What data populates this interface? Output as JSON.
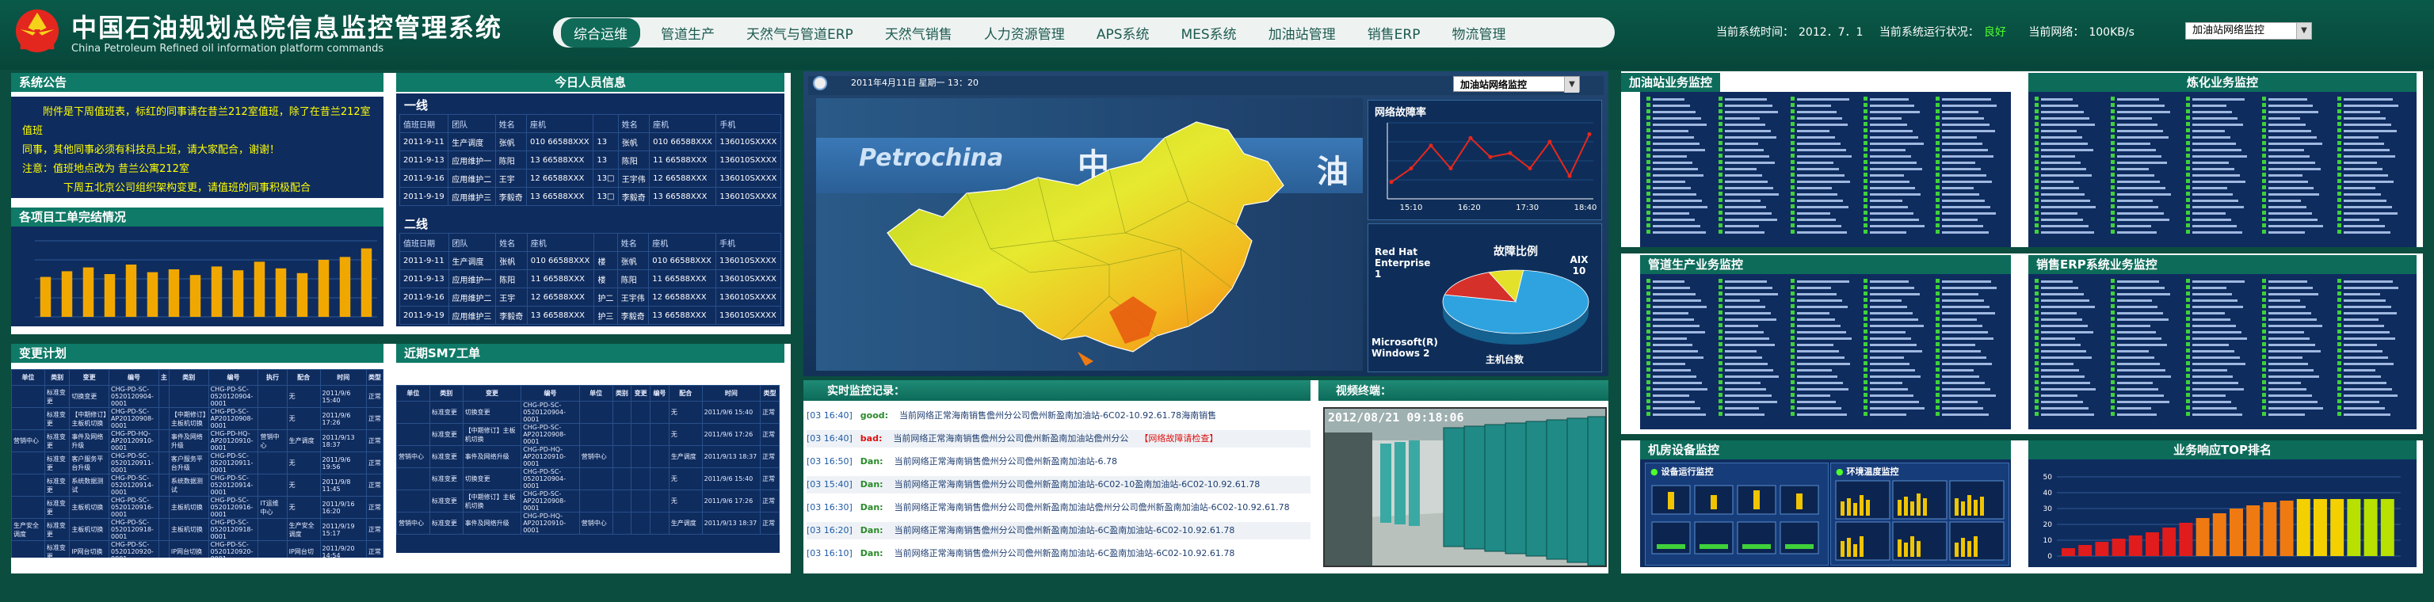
{
  "header": {
    "title_cn": "中国石油规划总院信息监控管理系统",
    "title_en": "China Petroleum Refined oil information platform commands",
    "nav": [
      "综合运维",
      "管道生产",
      "天然气与管道ERP",
      "天然气销售",
      "人力资源管理",
      "APS系统",
      "MES系统",
      "加油站管理",
      "销售ERP",
      "物流管理"
    ],
    "status": {
      "time_label": "当前系统时间：",
      "time_value": "2012．7．1",
      "run_label": "当前系统运行状况：",
      "run_value": "良好",
      "net_label": "当前网络：",
      "net_value": "100KB/s"
    },
    "select_value": "加油站网络监控"
  },
  "notice": {
    "title": "系统公告",
    "lines": [
      "附件是下周值班表，标红的同事请在昔兰212室值班，除了在昔兰212室值班",
      "同事，其他同事必须有科技员上班，请大家配合，谢谢！",
      "注意：值班地点改为  昔兰公寓212室",
      "下周五北京公司组织架构变更，请值班的同事积极配合"
    ]
  },
  "bar_chart": {
    "title": "各项目工单完结情况",
    "type": "bar",
    "values": [
      42,
      48,
      52,
      45,
      55,
      47,
      50,
      44,
      53,
      49,
      58,
      51,
      46,
      60,
      63,
      72
    ]
  },
  "duty": {
    "title": "今日人员信息",
    "line1": "一线",
    "line2": "二线",
    "headers": [
      "值班日期",
      "团队",
      "姓名",
      "座机",
      "",
      "姓名",
      "座机",
      "手机"
    ],
    "rows1": [
      [
        "2011-9-11",
        "生产调度",
        "张帆",
        "010 66588XXX",
        "13",
        "张帆",
        "010 66588XXX",
        "136010SXXXX"
      ],
      [
        "2011-9-13",
        "应用维护一",
        "陈阳",
        "13 66588XXX",
        "13",
        "陈阳",
        "11 66588XXX",
        "136010SXXXX"
      ],
      [
        "2011-9-16",
        "应用维护二",
        "王宇",
        "12 66588XXX",
        "13□",
        "王宇伟",
        "12 66588XXX",
        "136010SXXXX"
      ],
      [
        "2011-9-19",
        "应用维护三",
        "李毅奇",
        "13 66588XXX",
        "13□",
        "李毅奇",
        "13 66588XXX",
        "136010SXXXX"
      ]
    ],
    "rows2": [
      [
        "2011-9-11",
        "生产调度",
        "张帆",
        "010 66588XXX",
        "楼",
        "张帆",
        "010 66588XXX",
        "136010SXXXX"
      ],
      [
        "2011-9-13",
        "应用维护一",
        "陈阳",
        "11 66588XXX",
        "楼",
        "陈阳",
        "11 66588XXX",
        "136010SXXXX"
      ],
      [
        "2011-9-16",
        "应用维护二",
        "王宇",
        "12 66588XXX",
        "护二",
        "王宇伟",
        "12 66588XXX",
        "136010SXXXX"
      ],
      [
        "2011-9-19",
        "应用维护三",
        "李毅奇",
        "13 66588XXX",
        "护三",
        "李毅奇",
        "13 66588XXX",
        "136010SXXXX"
      ]
    ]
  },
  "change": {
    "title": "变更计划",
    "headers": [
      "单位",
      "类别",
      "变更",
      "编号",
      "主",
      "类别",
      "编号",
      "执行",
      "配合",
      "时间",
      "类型"
    ],
    "rows": [
      [
        "",
        "标准变更",
        "切换变更",
        "CHG-PD-SC-0520120904-0001",
        "",
        "",
        "CHG-PD-SC-0520120904-0001",
        "",
        "无",
        "2011/9/6 15:40",
        "正常"
      ],
      [
        "",
        "标准变更",
        "【中期修订】主板机切换",
        "CHG-PD-SC-AP20120908-0001",
        "",
        "【中期修订】主板机切换",
        "CHG-PD-SC-AP20120908-0001",
        "",
        "无",
        "2011/9/6 17:26",
        "正常"
      ],
      [
        "营销中心",
        "标准变更",
        "事件及网络升级",
        "CHG-PD-HQ-AP20120910-0001",
        "",
        "事件及网络升级",
        "CHG-PD-HQ-AP20120910-0001",
        "营销中心",
        "生产调度",
        "2011/9/13 18:37",
        "正常"
      ],
      [
        "",
        "标准变更",
        "客户服务平台升级",
        "CHG-PD-SC-0520120911-0001",
        "",
        "客户服务平台升级",
        "CHG-PD-SC-0520120911-0001",
        "",
        "无",
        "2011/9/6 19:56",
        "正常"
      ],
      [
        "",
        "标准变更",
        "系统数据测试",
        "CHG-PD-SC-0520120914-0001",
        "",
        "系统数据测试",
        "CHG-PD-SC-0520120914-0001",
        "",
        "无",
        "2011/9/8 11:45",
        "正常"
      ],
      [
        "",
        "标准变更",
        "主板机切换",
        "CHG-PD-SC-0520120916-0001",
        "",
        "主板机切换",
        "CHG-PD-SC-0520120916-0001",
        "IT运维中心",
        "无",
        "2011/9/16 16:20",
        "正常"
      ],
      [
        "生产安全调度",
        "标准变更",
        "主板机切换",
        "CHG-PD-SC-0520120918-0001",
        "",
        "主板机切换",
        "CHG-PD-SC-0520120918-0001",
        "",
        "生产安全调度",
        "2011/9/19 15:17",
        "正常"
      ],
      [
        "",
        "标准变更",
        "IP网台切换",
        "CHG-PD-SC-0520120920-0001",
        "",
        "IP网台切换",
        "CHG-PD-SC-0520120920-0001",
        "",
        "IP网台切",
        "2011/9/20 14:54",
        "正常"
      ]
    ]
  },
  "sm7": {
    "title": "近期SM7工单",
    "headers": [
      "单位",
      "类别",
      "变更",
      "编号",
      "单位",
      "类别",
      "变更",
      "编号",
      "配合",
      "时间",
      "类型"
    ],
    "rows": [
      [
        "",
        "标准变更",
        "切换变更",
        "CHG-PD-SC-0520120904-0001",
        "",
        "",
        "",
        "",
        "无",
        "2011/9/6 15:40",
        "正常"
      ],
      [
        "",
        "标准变更",
        "【中期修订】主板机切换",
        "CHG-PD-SC-AP20120908-0001",
        "",
        "",
        "",
        "",
        "无",
        "2011/9/6 17:26",
        "正常"
      ],
      [
        "营销中心",
        "标准变更",
        "事件及网络升级",
        "CHG-PD-HQ-AP20120910-0001",
        "营销中心",
        "",
        "",
        "",
        "生产调度",
        "2011/9/13 18:37",
        "正常"
      ],
      [
        "",
        "标准变更",
        "切换变更",
        "CHG-PD-SC-0520120904-0001",
        "",
        "",
        "",
        "",
        "无",
        "2011/9/6 15:40",
        "正常"
      ],
      [
        "",
        "标准变更",
        "【中期修订】主板机切换",
        "CHG-PD-SC-AP20120908-0001",
        "",
        "",
        "",
        "",
        "无",
        "2011/9/6 17:26",
        "正常"
      ],
      [
        "营销中心",
        "标准变更",
        "事件及网络升级",
        "CHG-PD-HQ-AP20120910-0001",
        "营销中心",
        "",
        "",
        "",
        "生产调度",
        "2011/9/13 18:37",
        "正常"
      ]
    ]
  },
  "map": {
    "date": "2011年4月11日  星期一  13：20",
    "select_value": "加油站网络监控",
    "banner_text": "Petrochina",
    "banner_cn1": "中",
    "banner_cn2": "油"
  },
  "fault_chart": {
    "title": "网络故障率",
    "type": "line",
    "x": [
      "15:10",
      "16:20",
      "17:30",
      "18:40"
    ],
    "values": [
      22,
      40,
      70,
      40,
      80,
      55,
      60,
      40,
      75,
      30,
      85
    ]
  },
  "pie": {
    "title": "故障比例",
    "subtitle": "主机台数",
    "labels": [
      "Red Hat Enterprise 1",
      "AIX 10",
      "Microsoft(R) Windows 2"
    ],
    "values": [
      1,
      10,
      2
    ],
    "colors": [
      "#e4e12a",
      "#2fa3df",
      "#d6302b"
    ]
  },
  "realtime": {
    "title": "实时监控记录：",
    "rows": [
      {
        "t": "[03 16:40]",
        "lv": "good:",
        "msg": "当前网络正常海南销售儋州分公司儋州新盈南加油站-6C02-10.92.61.78海南销售",
        "warn": "",
        "bad": false
      },
      {
        "t": "[03 16:40]",
        "lv": "bad:",
        "msg": "当前网络正常海南销售儋州分公司儋州新盈南加油站儋州分公",
        "warn": "【网络故障请检查】",
        "bad": true
      },
      {
        "t": "[03 16:50]",
        "lv": "Dan:",
        "msg": "当前网络正常海南销售儋州分公司儋州新盈南加油站-6.78",
        "warn": "",
        "bad": false
      },
      {
        "t": "[03 15:40]",
        "lv": "Dan:",
        "msg": "当前网络正常海南销售儋州分公司儋州新盈南加油站-6C02-10盈南加油站-6C02-10.92.61.78",
        "warn": "",
        "bad": false
      },
      {
        "t": "[03 16:30]",
        "lv": "Dan:",
        "msg": "当前网络正常海南销售儋州分公司儋州新盈南加油站儋州分公司儋州新盈南加油站-6C02-10.92.61.78",
        "warn": "",
        "bad": false
      },
      {
        "t": "[03 16:20]",
        "lv": "Dan:",
        "msg": "当前网络正常海南销售儋州分公司儋州新盈南加油站-6C盈南加油站-6C02-10.92.61.78",
        "warn": "",
        "bad": false
      },
      {
        "t": "[03 16:10]",
        "lv": "Dan:",
        "msg": "当前网络正常海南销售儋州分公司儋州新盈南加油站-6C盈南加油站-6C02-10.92.61.78",
        "warn": "",
        "bad": false
      }
    ]
  },
  "video": {
    "title": "视频终端：",
    "timestamp": "2012/08/21 09:18:06"
  },
  "right_panels": {
    "gas": "加油站业务监控",
    "refinery": "炼化业务监控",
    "pipeline": "管道生产业务监控",
    "sales_erp": "销售ERP系统业务监控",
    "room": "机房设备监控",
    "resp": "业务响应TOP排名",
    "dev_monitor": "设备运行监控",
    "env_monitor": "环境温度监控"
  },
  "top_chart": {
    "type": "bar",
    "yticks": [
      "50",
      "40",
      "30",
      "20",
      "10",
      "0"
    ],
    "values": [
      5,
      7,
      9,
      11,
      13,
      15,
      18,
      21,
      24,
      27,
      30,
      32,
      34,
      35,
      36,
      36,
      36,
      36,
      36,
      36
    ]
  },
  "colors": {
    "bg": "#0b4d3f",
    "panel_title": "#0d6b5a",
    "navy": "#0f2c5f",
    "bar": "#f0a800"
  }
}
